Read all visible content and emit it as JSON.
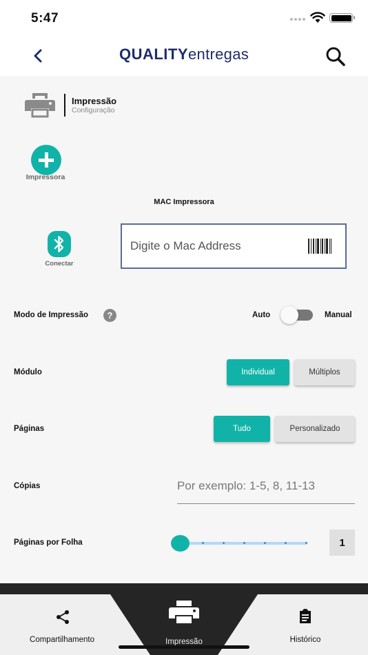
{
  "status_bar": {
    "time": "5:47"
  },
  "header": {
    "logo_bold": "QUALITY",
    "logo_light": "entregas"
  },
  "page": {
    "title": "Impressão",
    "subtitle": "Configuração"
  },
  "printer": {
    "add_label": "Impressora",
    "mac_label": "MAC Impressora",
    "connect_label": "Conectar",
    "mac_placeholder": "Digite o Mac Address",
    "mac_value": ""
  },
  "print_mode": {
    "label": "Modo de Impressão",
    "help": "?",
    "left_option": "Auto",
    "right_option": "Manual",
    "value": "Auto"
  },
  "module": {
    "label": "Módulo",
    "options": [
      "Individual",
      "Múltiplos"
    ],
    "selected": "Individual"
  },
  "pages": {
    "label": "Páginas",
    "options": [
      "Tudo",
      "Personalizado"
    ],
    "selected": "Tudo"
  },
  "copies": {
    "label": "Cópias",
    "placeholder": "Por exemplo: 1-5, 8, 11-13",
    "value": ""
  },
  "pages_per_sheet": {
    "label": "Páginas por Folha",
    "value": "1",
    "slider_steps": 7,
    "slider_position": 0
  },
  "bottom_nav": {
    "tabs": [
      {
        "label": "Compartilhamento",
        "icon": "share-icon"
      },
      {
        "label": "Impressão",
        "icon": "printer-icon"
      },
      {
        "label": "Histórico",
        "icon": "clipboard-icon"
      }
    ],
    "active": "Impressão"
  },
  "colors": {
    "accent": "#11b3a8",
    "brand": "#1d2d6b",
    "dark_band": "#252525"
  }
}
